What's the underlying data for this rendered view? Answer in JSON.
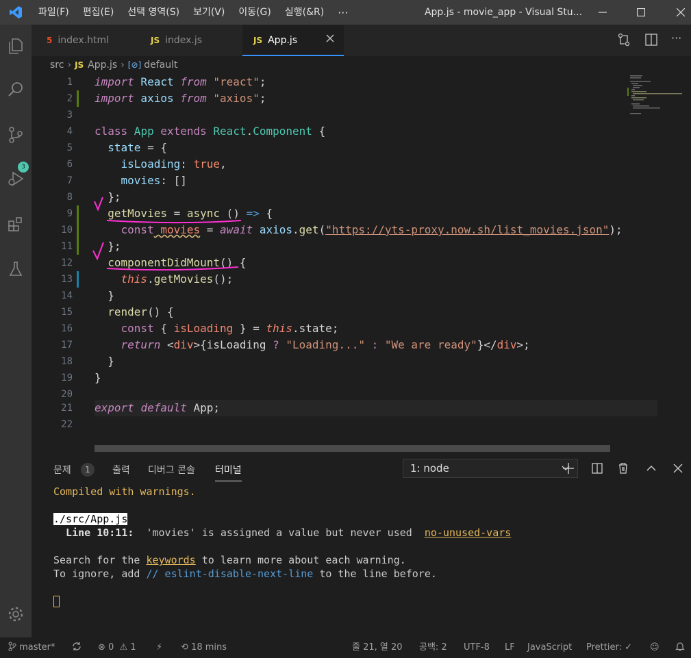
{
  "menu": [
    "파일(F)",
    "편집(E)",
    "선택 영역(S)",
    "보기(V)",
    "이동(G)",
    "실행(&R)"
  ],
  "menu_more": "···",
  "window_title": "App.js - movie_app - Visual Stu...",
  "tabs": [
    {
      "icon": "5",
      "label": "index.html"
    },
    {
      "icon": "JS",
      "label": "index.js"
    },
    {
      "icon": "JS",
      "label": "App.js"
    }
  ],
  "breadcrumb": {
    "folder": "src",
    "file_icon": "JS",
    "file": "App.js",
    "symbol": "default"
  },
  "scm_badge": "3",
  "line_numbers": [
    "1",
    "2",
    "3",
    "4",
    "5",
    "6",
    "7",
    "8",
    "9",
    "10",
    "11",
    "12",
    "13",
    "14",
    "15",
    "16",
    "17",
    "18",
    "19",
    "20",
    "21",
    "22"
  ],
  "code": {
    "l1": {
      "a": "import",
      "b": " React ",
      "c": "from",
      "d": " \"react\"",
      "e": ";"
    },
    "l2": {
      "a": "import",
      "b": " axios ",
      "c": "from",
      "d": " \"axios\"",
      "e": ";"
    },
    "l4": {
      "a": "class",
      "b": " App ",
      "c": "extends",
      "d": " React",
      "e": ".",
      "f": "Component",
      "g": " {"
    },
    "l5": {
      "a": "  state",
      "b": " = {"
    },
    "l6": {
      "a": "    isLoading",
      "b": ": ",
      "c": "true",
      "d": ","
    },
    "l7": {
      "a": "    movies",
      "b": ": []"
    },
    "l8": "  };",
    "l9": {
      "a": "  getMovies",
      "b": " = ",
      "c": "async",
      "d": " () ",
      "e": "=>",
      "f": " {"
    },
    "l10": {
      "a": "    const",
      "b": " movies",
      "c": " = ",
      "d": "await",
      "e": " axios",
      "f": ".",
      "g": "get",
      "h": "(",
      "i": "\"https://yts-proxy.now.sh/list_movies.json\"",
      "j": ");"
    },
    "l11": "  };",
    "l12": {
      "a": "  componentDidMount",
      "b": "() {"
    },
    "l13": {
      "a": "    this",
      "b": ".",
      "c": "getMovies",
      "d": "();"
    },
    "l14": "  }",
    "l15": {
      "a": "  render",
      "b": "() {"
    },
    "l16": {
      "a": "    const",
      "b": " { ",
      "c": "isLoading",
      "d": " } = ",
      "e": "this",
      "f": ".state;"
    },
    "l17": {
      "a": "    return",
      "b": " <",
      "c": "div",
      "d": ">{isLoading ",
      "e": "?",
      "f": " \"Loading...\"",
      "g": " : ",
      "h": "\"We are ready\"",
      "i": "}</",
      "j": "div",
      "k": ">;"
    },
    "l18": "  }",
    "l19": "}",
    "l21": {
      "a": "export",
      "b": " ",
      "c": "default",
      "d": " App;"
    }
  },
  "panel": {
    "tabs": [
      "문제",
      "출력",
      "디버그 콘솔",
      "터미널"
    ],
    "problems_count": "1",
    "terminal_select": "1: node"
  },
  "terminal": {
    "line1": "Compiled with warnings.",
    "file": "./src/App.js",
    "warn_loc": "  Line 10:11:",
    "warn_msg": "  'movies' is assigned a value but never used  ",
    "warn_rule": "no-unused-vars",
    "search_a": "Search for the ",
    "search_kw": "keywords",
    "search_b": " to learn more about each warning.",
    "ignore_a": "To ignore, add ",
    "ignore_kw": "// eslint-disable-next-line",
    "ignore_b": " to the line before."
  },
  "status": {
    "branch": "master*",
    "errors": "0",
    "warnings": "1",
    "time": "18 mins",
    "position": "줄 21, 열 20",
    "spaces": "공백: 2",
    "encoding": "UTF-8",
    "eol": "LF",
    "language": "JavaScript",
    "prettier": "Prettier: ✓"
  },
  "colors": {
    "accent": "#3794ff",
    "warning": "#e5b95c",
    "annotation": "#ff2fd4"
  }
}
